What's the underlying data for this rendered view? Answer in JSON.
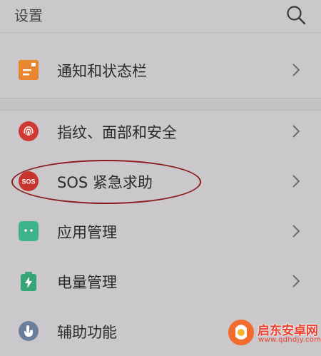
{
  "header": {
    "title": "设置",
    "search_icon": "search-icon"
  },
  "items": [
    {
      "label": "通知和状态栏",
      "icon": "notification-icon",
      "color": "#e8852f"
    },
    {
      "label": "指纹、面部和安全",
      "icon": "fingerprint-icon",
      "color": "#cf3b33"
    },
    {
      "label": "SOS 紧急求助",
      "icon": "sos-icon",
      "icon_text": "SOS",
      "color": "#c8342f"
    },
    {
      "label": "应用管理",
      "icon": "android-icon",
      "color": "#3fb18b"
    },
    {
      "label": "电量管理",
      "icon": "battery-icon",
      "color": "#36a578"
    },
    {
      "label": "辅助功能",
      "icon": "hand-icon",
      "color": "#6a7d9a"
    }
  ],
  "watermark": {
    "title": "启东安卓网",
    "url": "www.qdhdjy.com"
  },
  "colors": {
    "background": "#cbc8cb",
    "highlight_ring": "#8b1a1e",
    "watermark": "#e8412f"
  }
}
